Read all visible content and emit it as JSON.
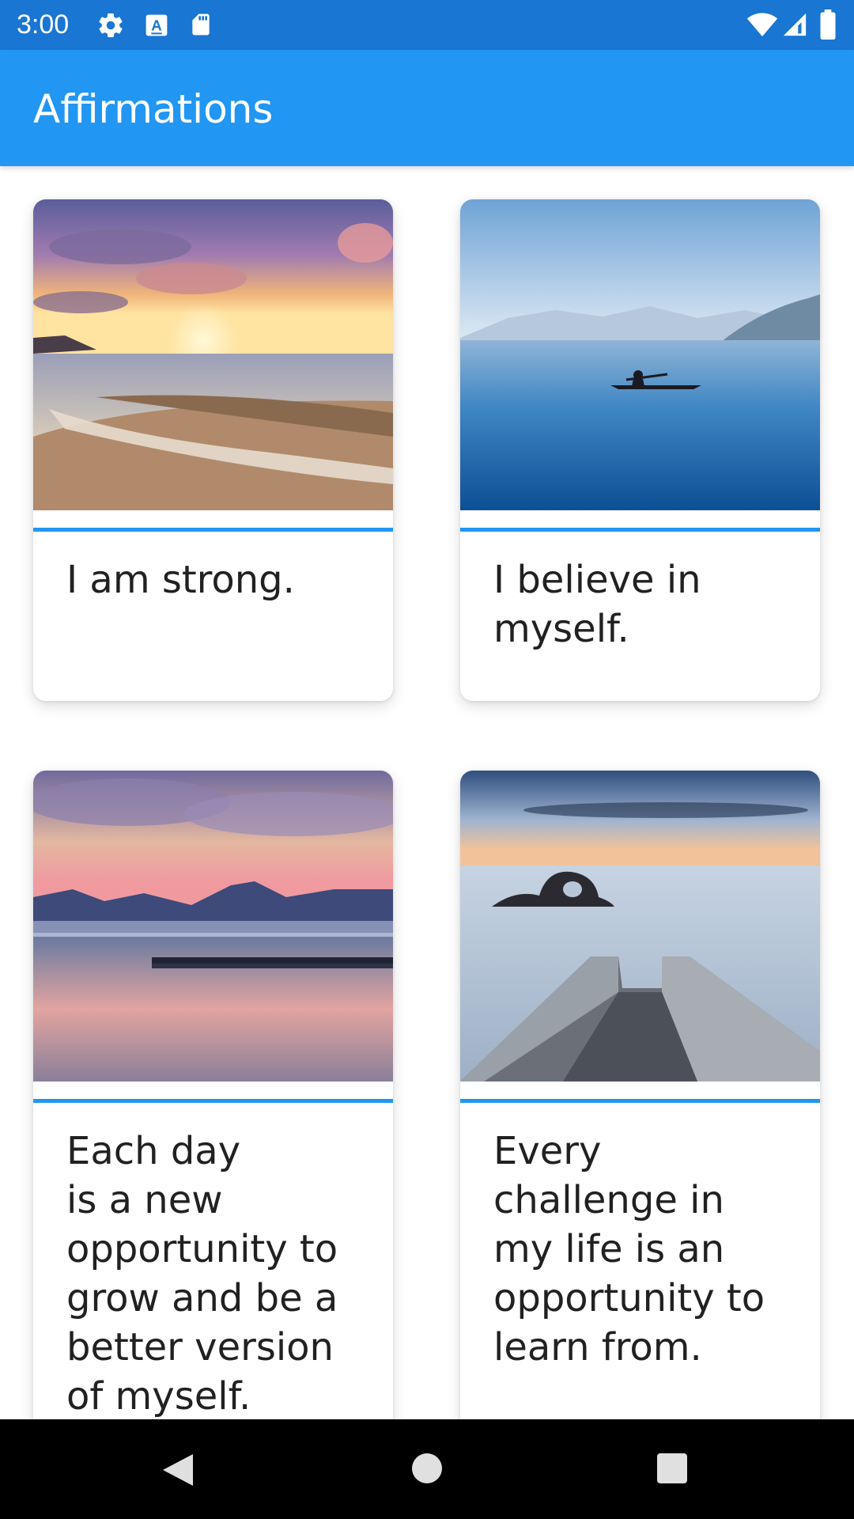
{
  "status_bar": {
    "time": "3:00",
    "icons": [
      "gear-icon",
      "a11y-a-icon",
      "sd-card-icon",
      "wifi-icon",
      "signal-icon",
      "battery-icon"
    ]
  },
  "app_bar": {
    "title": "Affirmations",
    "color": "#2196F3",
    "status_color": "#1976D2"
  },
  "affirmations": [
    {
      "text": "I am strong.",
      "image": "sunset-beach-image"
    },
    {
      "text": "I believe in\nmyself.",
      "image": "kayak-lake-image"
    },
    {
      "text": "Each day\nis a new\nopportunity to\ngrow and be a\nbetter version\nof myself.",
      "image": "mountain-lake-sunset-image"
    },
    {
      "text": "Every\nchallenge in\nmy life is an\nopportunity to\nlearn from.",
      "image": "pier-sea-rock-image"
    }
  ],
  "nav_bar": {
    "buttons": [
      "back-icon",
      "home-icon",
      "recents-icon"
    ]
  }
}
